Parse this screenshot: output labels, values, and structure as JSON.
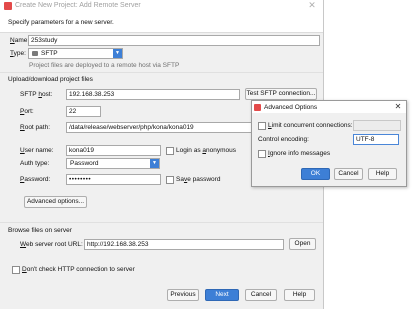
{
  "main_dialog": {
    "title": "Create New Project: Add Remote Server",
    "close_glyph": "✕",
    "header_text": "Specify parameters for a new server.",
    "name": {
      "label_u": "N",
      "label_rest": "ame:",
      "value": "253study"
    },
    "type": {
      "label_u": "T",
      "label_rest": "ype:",
      "value": "SFTP",
      "icon": "sftp-icon",
      "hint": "Project files are deployed to a remote host via SFTP"
    },
    "upload_section_title": "Upload/download project files",
    "sftp_host": {
      "label_pre": "SFTP ",
      "label_u": "h",
      "label_rest": "ost:",
      "value": "192.168.38.253"
    },
    "test_button_label": "Test SFTP connection...",
    "port": {
      "label_u": "P",
      "label_rest": "ort:",
      "value": "22"
    },
    "root_path": {
      "label_u": "R",
      "label_rest": "oot path:",
      "value": "/data/release/webserver/php/kona/kona019"
    },
    "user_name": {
      "label_u": "U",
      "label_rest": "ser name:",
      "value": "kona019"
    },
    "login_anonymous": {
      "label_pre": "Login as ",
      "label_u": "a",
      "label_rest": "nonymous"
    },
    "auth_type": {
      "label": "Auth type:",
      "value": "Password"
    },
    "password": {
      "label_u": "P",
      "label_rest": "assword:",
      "value": "••••••••"
    },
    "save_password": {
      "label_pre": "Sa",
      "label_u": "v",
      "label_rest": "e password"
    },
    "advanced_button_label": "Advanced options...",
    "browse_section_title": "Browse files on server",
    "web_root": {
      "label_u": "W",
      "label_rest": "eb server root URL:",
      "value": "http://192.168.38.253"
    },
    "open_button_label": "Open",
    "dont_check": {
      "label_u": "D",
      "label_rest": "on't check HTTP connection to server"
    },
    "footer": {
      "previous": "Previous",
      "next": "Next",
      "cancel": "Cancel",
      "help": "Help"
    }
  },
  "advanced_dialog": {
    "title": "Advanced Options",
    "close_glyph": "✕",
    "limit_connections": {
      "label_u": "L",
      "label_rest": "imit concurrent connections:"
    },
    "control_encoding": {
      "label": "Control encoding:",
      "value": "UTF-8"
    },
    "ignore_info": {
      "label_u": "I",
      "label_rest": "gnore info messages"
    },
    "ok": "OK",
    "cancel": "Cancel",
    "help": "Help"
  },
  "colors": {
    "accent": "#3d7fd6",
    "dialog_bg": "#f0f0f0"
  }
}
